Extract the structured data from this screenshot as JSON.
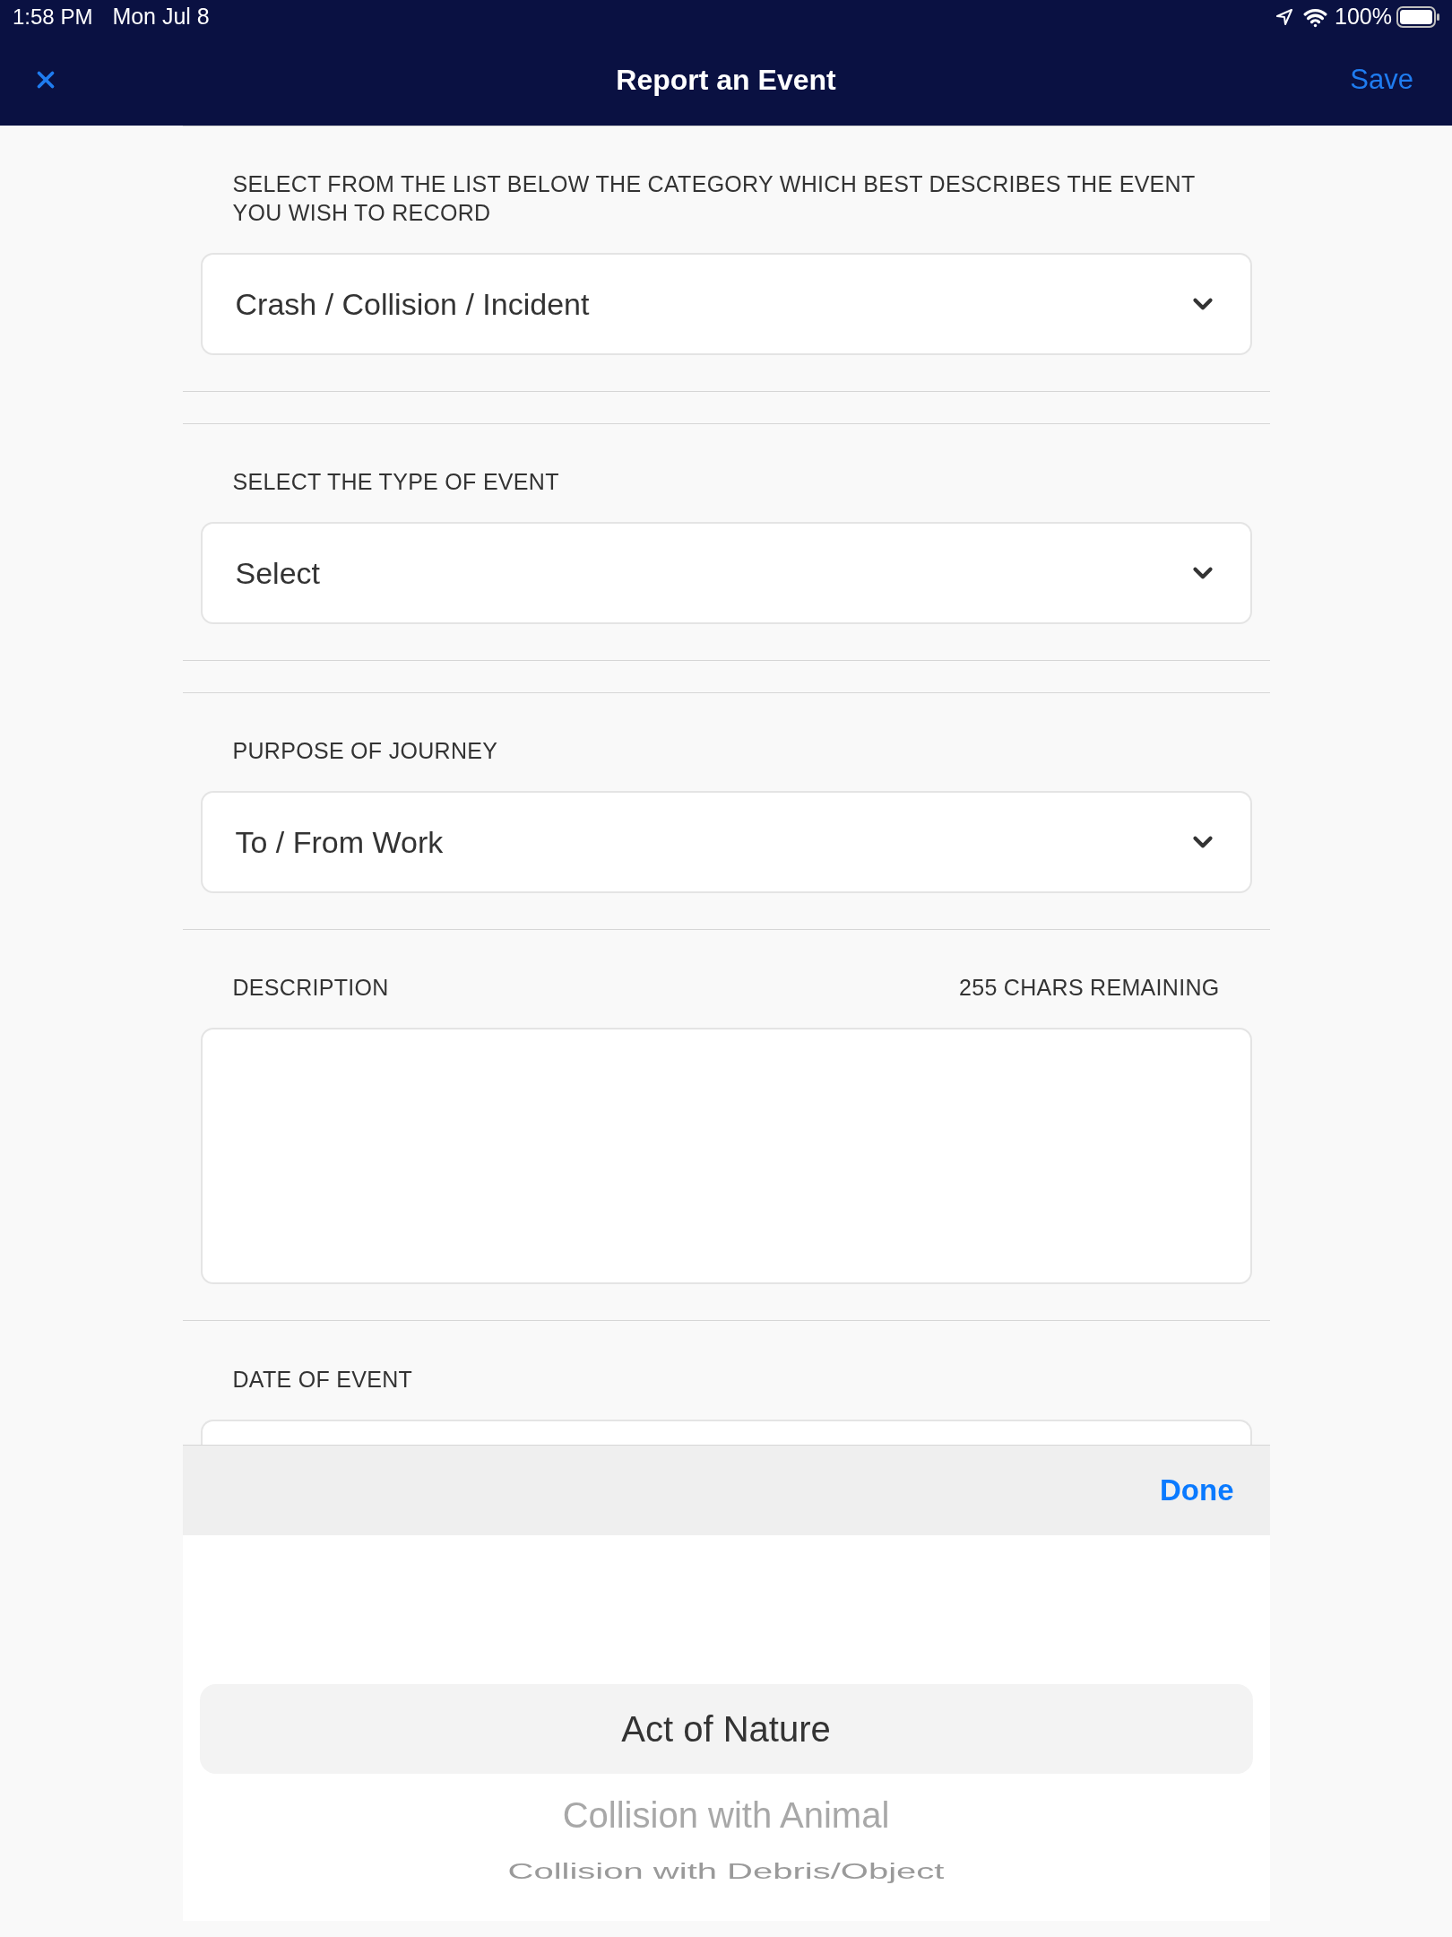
{
  "status_bar": {
    "time": "1:58 PM",
    "date": "Mon Jul 8",
    "battery_text": "100%"
  },
  "nav_bar": {
    "title": "Report an Event",
    "action": "Save"
  },
  "form": {
    "groups": [
      {
        "fields": [
          {
            "kind": "select",
            "label": "SELECT FROM THE LIST BELOW THE CATEGORY WHICH BEST DESCRIBES THE EVENT YOU WISH TO RECORD",
            "value": "Crash / Collision / Incident"
          }
        ]
      },
      {
        "fields": [
          {
            "kind": "select",
            "label": "SELECT THE TYPE OF EVENT",
            "value": "Select"
          }
        ]
      },
      {
        "fields": [
          {
            "kind": "select",
            "label": "PURPOSE OF JOURNEY",
            "value": "To / From Work"
          },
          {
            "kind": "textarea",
            "label": "DESCRIPTION",
            "counter": "255 CHARS REMAINING"
          },
          {
            "kind": "date",
            "label": "DATE OF EVENT"
          }
        ]
      }
    ]
  },
  "picker": {
    "done": "Done",
    "options": [
      {
        "label": "Act of Nature",
        "selected": true
      },
      {
        "label": "Collision with Animal",
        "selected": false
      },
      {
        "label": "Collision with Debris/Object",
        "selected": false
      }
    ]
  }
}
